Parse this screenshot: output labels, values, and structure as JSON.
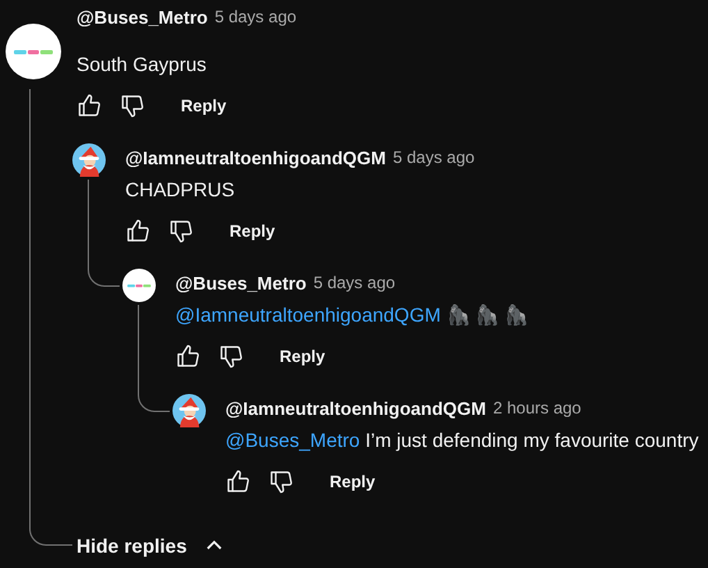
{
  "thread": {
    "author": "@Buses_Metro",
    "time": "5 days ago",
    "avatar": {
      "kind": "logo"
    },
    "text": "South Gayprus",
    "reply_label": "Reply",
    "children": [
      {
        "author": "@IamneutraltoenhigoandQGM",
        "time": "5 days ago",
        "avatar": {
          "kind": "figure"
        },
        "text": "CHADPRUS",
        "reply_label": "Reply",
        "children": [
          {
            "author": "@Buses_Metro",
            "time": "5 days ago",
            "avatar": {
              "kind": "logo"
            },
            "mention": "@IamneutraltoenhigoandQGM",
            "text": "🦍 🦍 🦍",
            "reply_label": "Reply",
            "children": [
              {
                "author": "@IamneutraltoenhigoandQGM",
                "time": "2 hours ago",
                "avatar": {
                  "kind": "figure"
                },
                "mention": "@Buses_Metro",
                "text": "I’m just defending my favourite country",
                "reply_label": "Reply"
              }
            ]
          }
        ]
      }
    ],
    "hide_replies": {
      "label": "Hide replies",
      "expanded": true
    }
  }
}
